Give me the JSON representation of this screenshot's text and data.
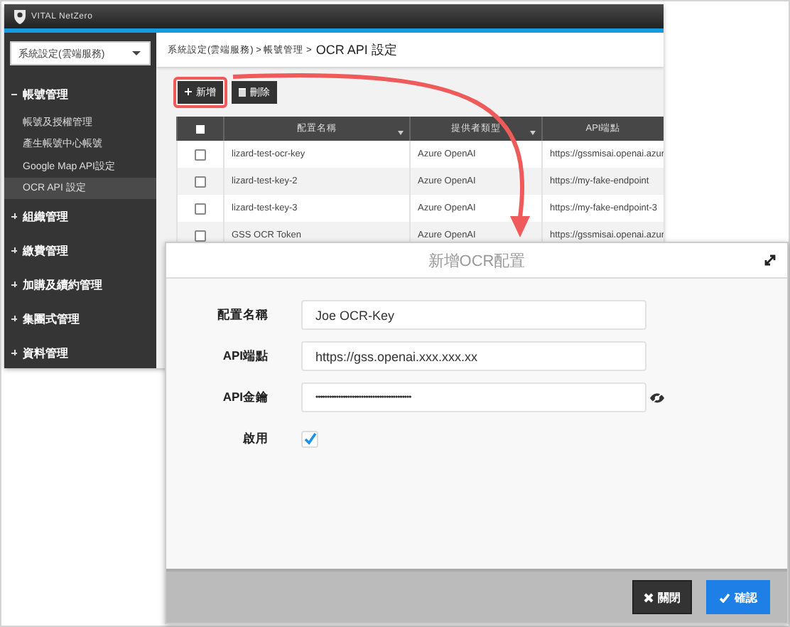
{
  "app": {
    "logo": "VITAL NetZero"
  },
  "sidebar": {
    "selector": "系統設定(雲端服務)",
    "groups": [
      {
        "label": "帳號管理",
        "expanded": true,
        "children": [
          {
            "label": "帳號及授權管理",
            "selected": false
          },
          {
            "label": "產生帳號中心帳號",
            "selected": false
          },
          {
            "label": "Google Map API設定",
            "selected": false
          },
          {
            "label": "OCR API 設定",
            "selected": true
          }
        ]
      },
      {
        "label": "組織管理",
        "expanded": false
      },
      {
        "label": "繳費管理",
        "expanded": false
      },
      {
        "label": "加購及續約管理",
        "expanded": false
      },
      {
        "label": "集團式管理",
        "expanded": false
      },
      {
        "label": "資料管理",
        "expanded": false
      }
    ]
  },
  "breadcrumb": {
    "path": "系統設定(雲端服務) > 帳號管理 >",
    "current": "OCR API 設定"
  },
  "toolbar": [
    {
      "label": "新增",
      "kind": "add",
      "highlighted": true
    },
    {
      "label": "刪除",
      "kind": "delete",
      "highlighted": false
    }
  ],
  "table": {
    "select_all": {
      "checked": false
    },
    "columns": [
      {
        "label": "配置名稱",
        "sortable": true
      },
      {
        "label": "提供者類型",
        "sortable": true
      },
      {
        "label": "API端點",
        "sortable": false
      }
    ],
    "rows": [
      {
        "checked": false,
        "cells": [
          "lizard-test-ocr-key",
          "Azure OpenAI",
          "https://gssmisai.openai.azur"
        ]
      },
      {
        "checked": false,
        "cells": [
          "lizard-test-key-2",
          "Azure OpenAI",
          "https://my-fake-endpoint"
        ]
      },
      {
        "checked": false,
        "cells": [
          "lizard-test-key-3",
          "Azure OpenAI",
          "https://my-fake-endpoint-3"
        ]
      },
      {
        "checked": false,
        "cells": [
          "GSS OCR Token",
          "Azure OpenAI",
          "https://gssmisai.openai.azur"
        ]
      }
    ]
  },
  "modal": {
    "title": "新增OCR配置",
    "fields": [
      {
        "kind": "text",
        "label": "配置名稱",
        "value": "Joe OCR-Key"
      },
      {
        "kind": "text",
        "label": "API端點",
        "value": "https://gss.openai.xxx.xxx.xx"
      },
      {
        "kind": "password",
        "label": "API金鑰",
        "value": "••••••••••••••••••••••••••••••••••••••••••"
      },
      {
        "kind": "checkbox",
        "label": "啟用",
        "checked": true
      }
    ],
    "buttons": [
      {
        "label": "關閉",
        "kind": "close"
      },
      {
        "label": "確認",
        "kind": "confirm"
      }
    ]
  }
}
